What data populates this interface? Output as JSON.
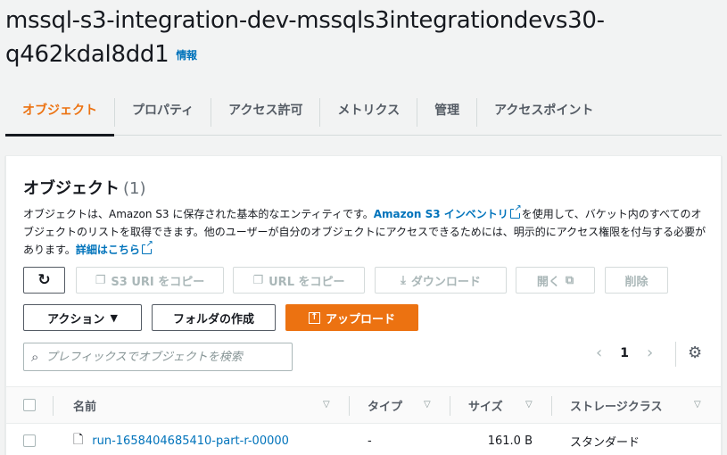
{
  "page": {
    "title": "mssql-s3-integration-dev-mssqls3integrationdevs30-q462kdal8dd1",
    "info_label": "情報"
  },
  "tabs": [
    {
      "label": "オブジェクト",
      "active": true
    },
    {
      "label": "プロパティ"
    },
    {
      "label": "アクセス許可"
    },
    {
      "label": "メトリクス"
    },
    {
      "label": "管理"
    },
    {
      "label": "アクセスポイント"
    }
  ],
  "panel": {
    "title": "オブジェクト",
    "count": "(1)",
    "desc": {
      "part1": "オブジェクトは、Amazon S3 に保存された基本的なエンティティです。",
      "inventory_link": "Amazon S3 インベントリ",
      "part2": "を使用して、バケット内のすべてのオブジェクトのリストを取得できます。他のユーザーが自分のオブジェクトにアクセスできるためには、明示的にアクセス権限を付与する必要があります。",
      "details_link": "詳細はこちら"
    }
  },
  "toolbar": {
    "refresh_icon": "refresh-icon",
    "copy_s3_uri": "S3 URI をコピー",
    "copy_url": "URL をコピー",
    "download": "ダウンロード",
    "open": "開く",
    "delete": "削除",
    "actions": "アクション",
    "create_folder": "フォルダの作成",
    "upload": "アップロード"
  },
  "search": {
    "placeholder": "プレフィックスでオブジェクトを検索"
  },
  "pagination": {
    "current_page": "1"
  },
  "table": {
    "headers": {
      "name": "名前",
      "type": "タイプ",
      "size": "サイズ",
      "storage_class": "ストレージクラス"
    },
    "rows": [
      {
        "name": "run-1658404685410-part-r-00000",
        "type": "-",
        "size": "161.0 B",
        "storage_class": "スタンダード"
      }
    ]
  },
  "colors": {
    "accent": "#ec7211",
    "link": "#0073bb",
    "text": "#16191f",
    "muted": "#545b64"
  }
}
